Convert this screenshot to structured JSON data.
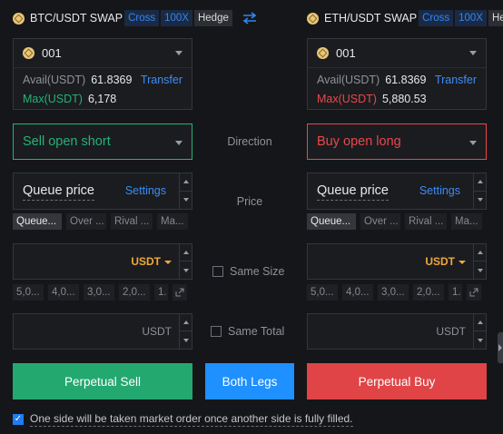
{
  "left": {
    "pair": "BTC/USDT SWAP",
    "tags": [
      "Cross",
      "100X",
      "Hedge"
    ],
    "account": "001",
    "avail_label": "Avail(USDT)",
    "avail_value": "61.8369",
    "transfer": "Transfer",
    "max_label": "Max(USDT)",
    "max_value": "6,178",
    "direction": "Sell open short",
    "price_mode": "Queue price",
    "settings": "Settings",
    "chips": [
      "Queue...",
      "Over ...",
      "Rival ...",
      "Ma..."
    ],
    "unit": "USDT",
    "pct_chips": [
      "5,0...",
      "4,0...",
      "3,0...",
      "2,0...",
      "1."
    ],
    "total_unit": "USDT",
    "button": "Perpetual Sell"
  },
  "right": {
    "pair": "ETH/USDT SWAP",
    "tags": [
      "Cross",
      "100X",
      "Hedge"
    ],
    "account": "001",
    "avail_label": "Avail(USDT)",
    "avail_value": "61.8369",
    "transfer": "Transfer",
    "max_label": "Max(USDT)",
    "max_value": "5,880.53",
    "direction": "Buy open long",
    "price_mode": "Queue price",
    "settings": "Settings",
    "chips": [
      "Queue...",
      "Over ...",
      "Rival ...",
      "Ma..."
    ],
    "unit": "USDT",
    "pct_chips": [
      "5,0...",
      "4,0...",
      "3,0...",
      "2,0...",
      "1."
    ],
    "total_unit": "USDT",
    "button": "Perpetual Buy"
  },
  "center": {
    "direction_label": "Direction",
    "price_label": "Price",
    "same_size": "Same Size",
    "same_total": "Same Total",
    "both_legs": "Both Legs"
  },
  "footer": {
    "note": "One side will be taken market order once another side is fully filled."
  },
  "colors": {
    "accent_blue": "#1e90ff",
    "sell_green": "#23a870",
    "buy_red": "#e04446",
    "unit_orange": "#f0a83a"
  },
  "icons": {
    "swap": "swap-arrows-icon",
    "coin": "coin-icon",
    "dropdown": "chevron-down-icon",
    "expand": "expand-icon",
    "check": "check-icon"
  }
}
